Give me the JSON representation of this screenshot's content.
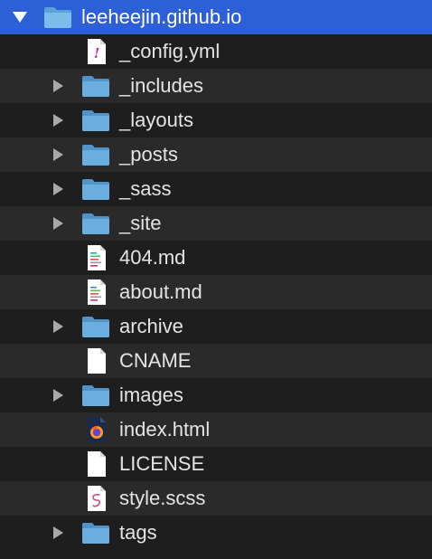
{
  "root": {
    "label": "leeheejin.github.io",
    "expanded": true,
    "icon": "folder-icon"
  },
  "items": [
    {
      "label": "_config.yml",
      "kind": "file",
      "icon": "yml-file-icon"
    },
    {
      "label": "_includes",
      "kind": "folder",
      "icon": "folder-icon",
      "expanded": false
    },
    {
      "label": "_layouts",
      "kind": "folder",
      "icon": "folder-icon",
      "expanded": false
    },
    {
      "label": "_posts",
      "kind": "folder",
      "icon": "folder-icon",
      "expanded": false
    },
    {
      "label": "_sass",
      "kind": "folder",
      "icon": "folder-icon",
      "expanded": false
    },
    {
      "label": "_site",
      "kind": "folder",
      "icon": "folder-icon",
      "expanded": false
    },
    {
      "label": "404.md",
      "kind": "file",
      "icon": "markdown-file-icon"
    },
    {
      "label": "about.md",
      "kind": "file",
      "icon": "markdown-file-icon"
    },
    {
      "label": "archive",
      "kind": "folder",
      "icon": "folder-icon",
      "expanded": false
    },
    {
      "label": "CNAME",
      "kind": "file",
      "icon": "blank-file-icon"
    },
    {
      "label": "images",
      "kind": "folder",
      "icon": "folder-icon",
      "expanded": false
    },
    {
      "label": "index.html",
      "kind": "file",
      "icon": "firefox-html-file-icon"
    },
    {
      "label": "LICENSE",
      "kind": "file",
      "icon": "blank-file-icon"
    },
    {
      "label": "style.scss",
      "kind": "file",
      "icon": "scss-file-icon"
    },
    {
      "label": "tags",
      "kind": "folder",
      "icon": "folder-icon",
      "expanded": false
    }
  ],
  "colors": {
    "selection": "#2d5fd6",
    "row_dark": "#1e1e1e",
    "row_light": "#2a2a2a",
    "folder_blue": "#6aaee0",
    "text": "#e4e4e4"
  }
}
